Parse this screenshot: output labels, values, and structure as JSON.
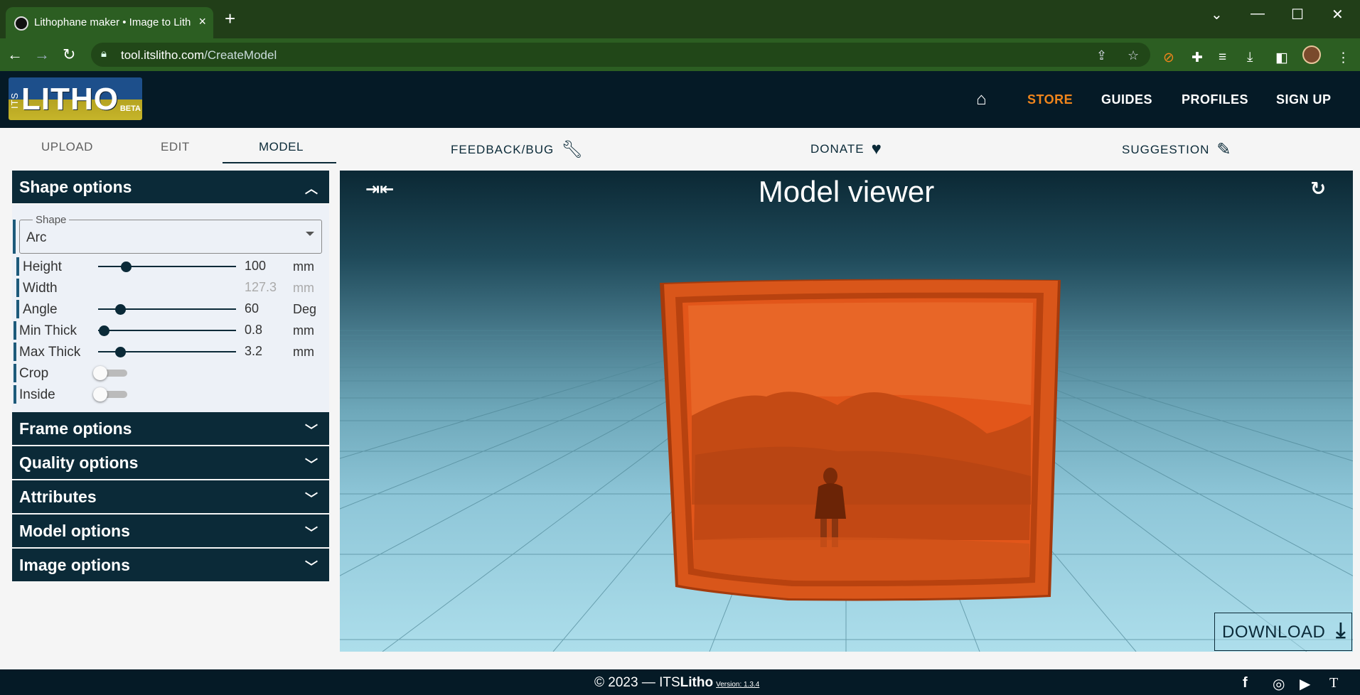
{
  "browser": {
    "tab_title": "Lithophane maker • Image to Lith",
    "tab_close": "×",
    "new_tab": "+",
    "url_domain": "tool.itslitho.com",
    "url_path": "/CreateModel",
    "back": "←",
    "forward": "→",
    "reload": "↻",
    "minimize": "—",
    "maximize": "☐",
    "close": "✕",
    "tab_search": "⌄"
  },
  "site": {
    "logo_its": "ITS",
    "logo_litho": "LITHO",
    "logo_beta": "BETA",
    "nav": {
      "store": "STORE",
      "guides": "GUIDES",
      "profiles": "PROFILES",
      "signup": "SIGN UP"
    }
  },
  "subnav": {
    "upload": "UPLOAD",
    "edit": "EDIT",
    "model": "MODEL",
    "feedback": "FEEDBACK/BUG",
    "donate": "DONATE",
    "suggestion": "SUGGESTION"
  },
  "panel": {
    "shape_options": {
      "title": "Shape options",
      "shape_label": "Shape",
      "shape_value": "Arc",
      "height": {
        "label": "Height",
        "value": "100",
        "unit": "mm",
        "slider_fraction": 0.2
      },
      "width": {
        "label": "Width",
        "value": "127.3",
        "unit": "mm"
      },
      "angle": {
        "label": "Angle",
        "value": "60",
        "unit": "Deg",
        "slider_fraction": 0.16
      },
      "min_thick": {
        "label": "Min Thick",
        "value": "0.8",
        "unit": "mm",
        "slider_fraction": 0.04
      },
      "max_thick": {
        "label": "Max Thick",
        "value": "3.2",
        "unit": "mm",
        "slider_fraction": 0.16
      },
      "crop": {
        "label": "Crop",
        "on": false
      },
      "inside": {
        "label": "Inside",
        "on": false
      }
    },
    "sections": [
      {
        "title": "Frame options"
      },
      {
        "title": "Quality options"
      },
      {
        "title": "Attributes"
      },
      {
        "title": "Model options"
      },
      {
        "title": "Image options"
      }
    ]
  },
  "viewer": {
    "title": "Model viewer",
    "download": "DOWNLOAD"
  },
  "footer": {
    "copyright": "© 2023 — ITS",
    "brand": "Litho",
    "version": "Version: 1.3.4"
  },
  "colors": {
    "brand_dark": "#0b2a38",
    "accent_store": "#f0851c",
    "model_orange": "#e2561a"
  }
}
